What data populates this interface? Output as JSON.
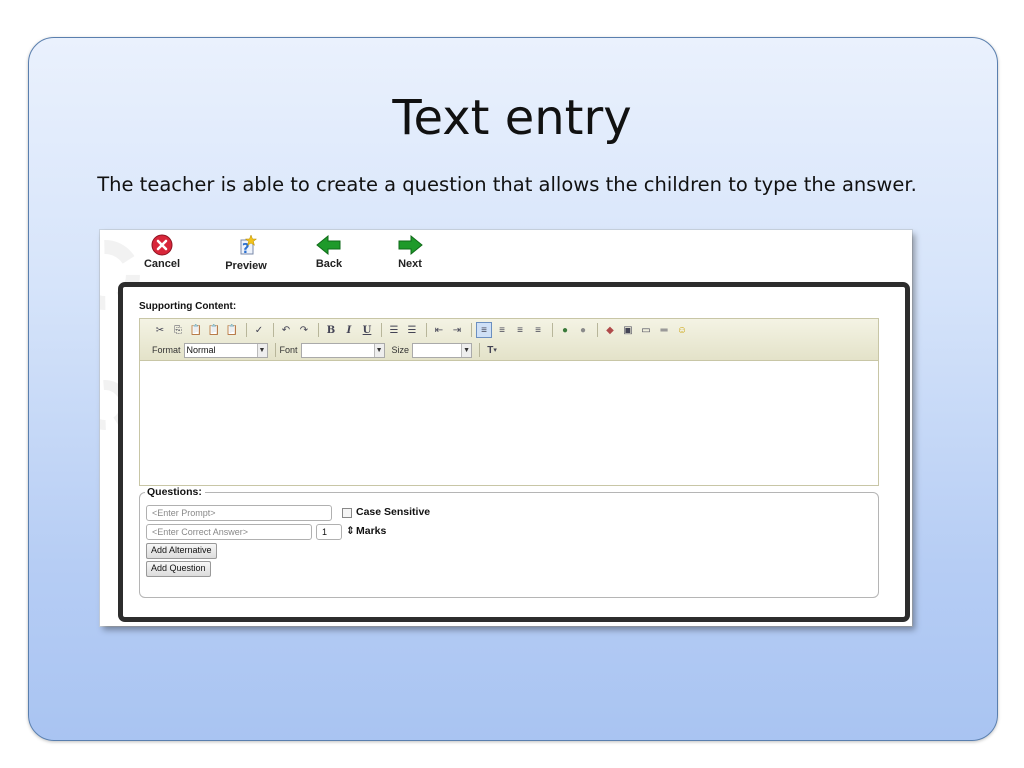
{
  "slide": {
    "title": "Text entry",
    "subtitle": "The teacher is able to create a question that allows the children to type the answer."
  },
  "nav": {
    "cancel": "Cancel",
    "preview": "Preview",
    "back": "Back",
    "next": "Next"
  },
  "editor": {
    "supporting_label": "Supporting Content:",
    "format_label": "Format",
    "format_value": "Normal",
    "font_label": "Font",
    "font_value": "",
    "size_label": "Size",
    "size_value": "",
    "toolbar_icons": [
      "cut-icon",
      "copy-icon",
      "paste-icon",
      "paste-text-icon",
      "paste-word-icon",
      "spellcheck-icon",
      "undo-icon",
      "redo-icon",
      "bold-icon",
      "italic-icon",
      "underline-icon",
      "numbered-list-icon",
      "bulleted-list-icon",
      "outdent-icon",
      "indent-icon",
      "align-left-icon",
      "align-center-icon",
      "align-right-icon",
      "justify-icon",
      "link-icon",
      "unlink-icon",
      "flash-icon",
      "image-icon",
      "table-icon",
      "horizontal-rule-icon",
      "smiley-icon",
      "text-color-icon"
    ]
  },
  "questions": {
    "legend": "Questions:",
    "prompt_placeholder": "<Enter Prompt>",
    "case_sensitive_label": "Case Sensitive",
    "answer_placeholder": "<Enter Correct Answer>",
    "marks_value": "1",
    "marks_label": "Marks",
    "add_alternative": "Add Alternative",
    "add_question": "Add Question"
  },
  "colors": {
    "cancel": "#d8263a",
    "arrow_green": "#1e9a2a",
    "slide_border": "#5a7fae"
  }
}
